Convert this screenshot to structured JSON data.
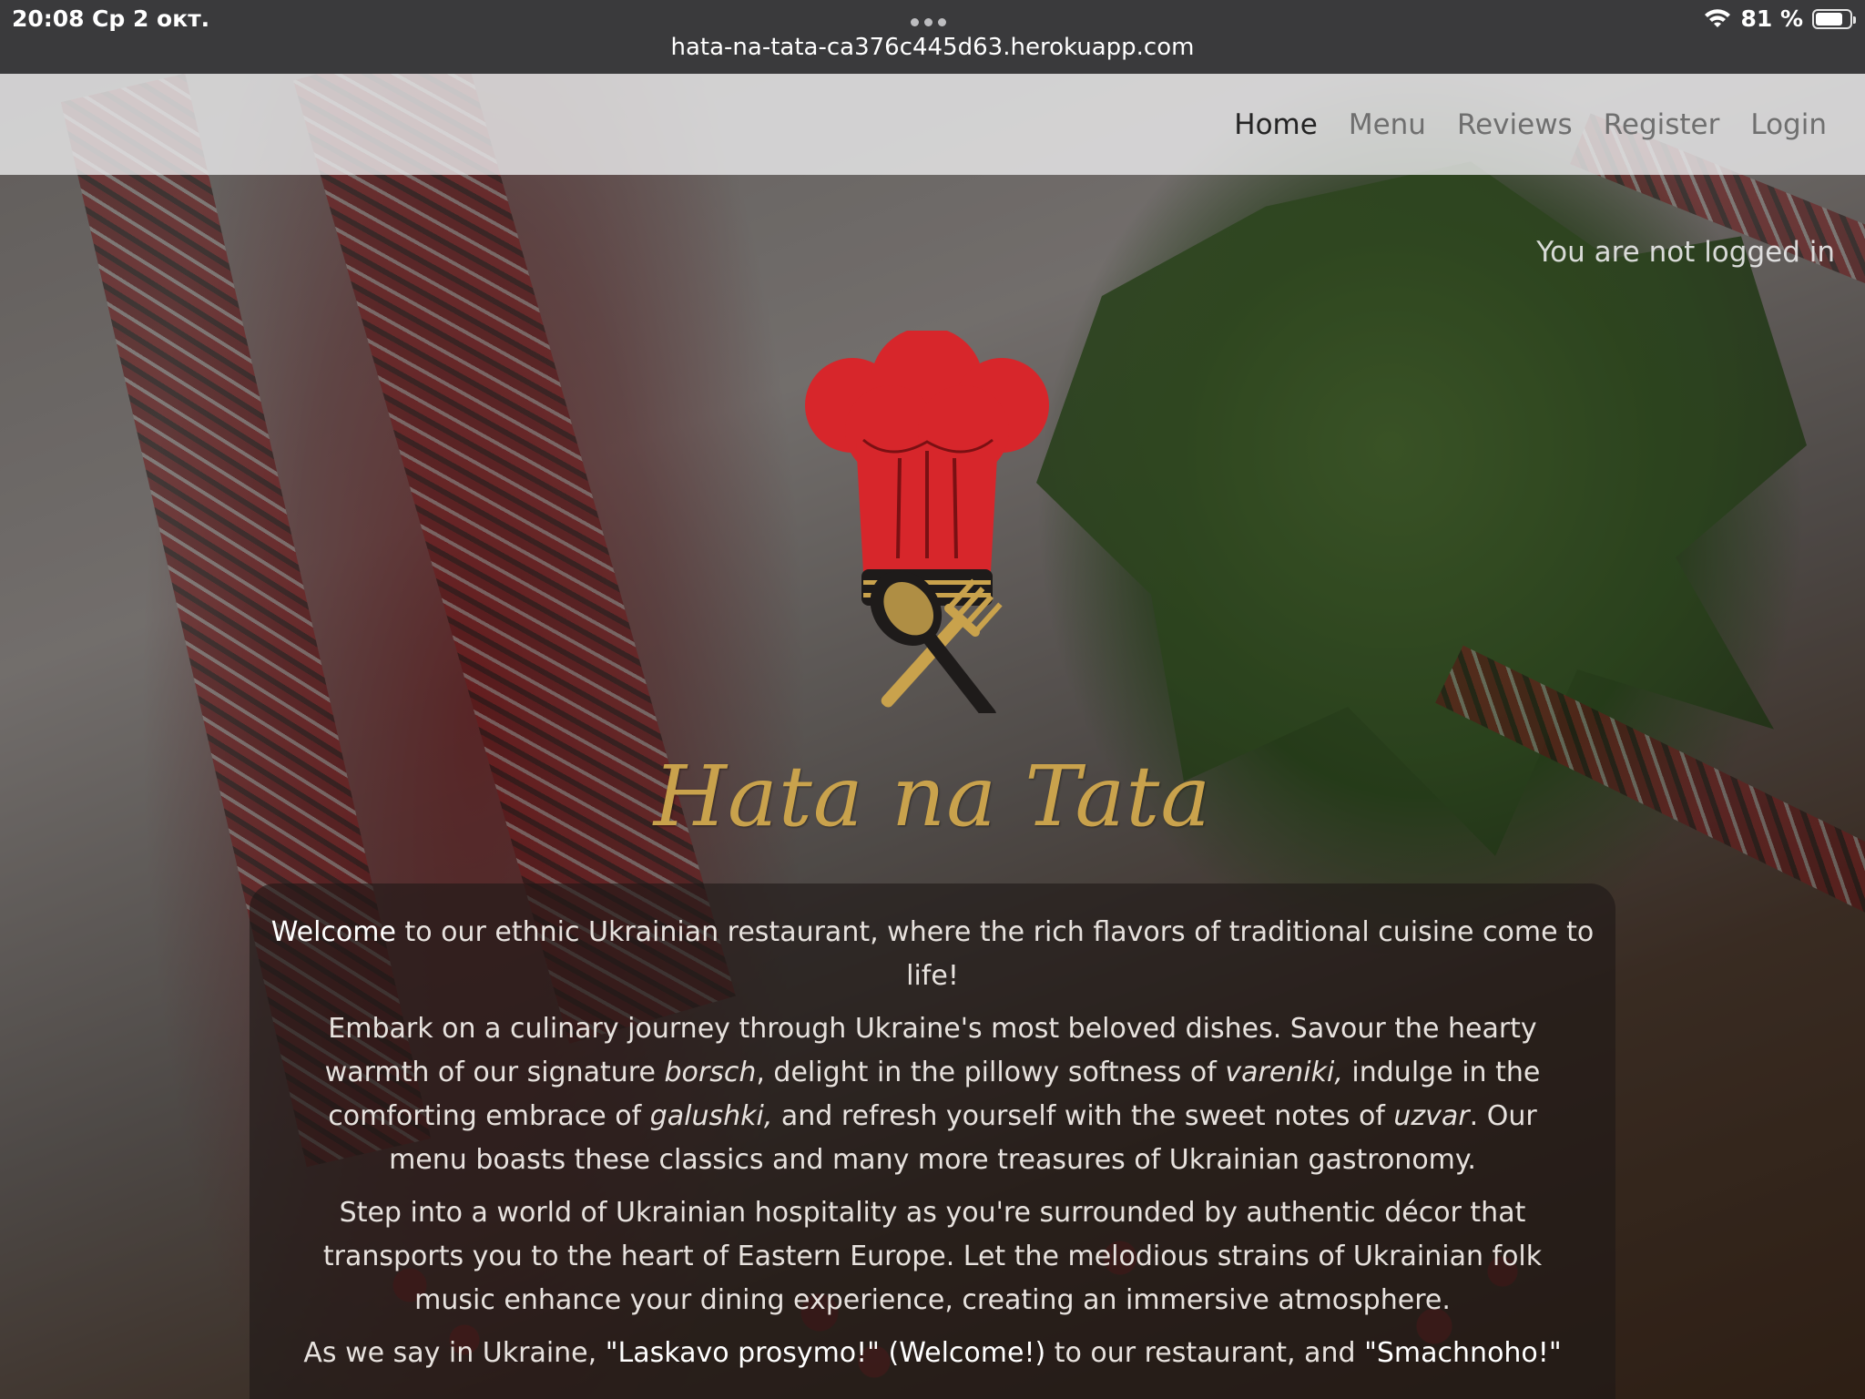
{
  "status_bar": {
    "time": "20:08",
    "date": "Ср 2 окт.",
    "battery": "81 %",
    "battery_level": 0.81,
    "url": "hata-na-tata-ca376c445d63.herokuapp.com"
  },
  "nav": {
    "items": [
      {
        "label": "Home",
        "active": true
      },
      {
        "label": "Menu",
        "active": false
      },
      {
        "label": "Reviews",
        "active": false
      },
      {
        "label": "Register",
        "active": false
      },
      {
        "label": "Login",
        "active": false
      }
    ]
  },
  "login_status": "You are not logged in",
  "brand": {
    "title": "Hata na Tata"
  },
  "content": {
    "p1": {
      "lead": "Welcome",
      "rest": " to our ethnic Ukrainian restaurant, where the rich flavors of traditional cuisine come to life!"
    },
    "p2": {
      "t1": "Embark on a culinary journey through Ukraine's most beloved dishes. Savour the hearty warmth of our signature ",
      "d1": "borsch",
      "t2": ", delight in the pillowy softness of ",
      "d2": "vareniki,",
      "t3": " indulge in the comforting embrace of ",
      "d3": "galushki,",
      "t4": " and refresh yourself with the sweet notes of ",
      "d4": "uzvar",
      "t5": ". Our menu boasts these classics and many more treasures of Ukrainian gastronomy."
    },
    "p3": "Step into a world of Ukrainian hospitality as you're surrounded by authentic décor that transports you to the heart of Eastern Europe. Let the melodious strains of Ukrainian folk music enhance your dining experience, creating an immersive atmosphere.",
    "p4": {
      "t1": "As we say in Ukraine, ",
      "h1": "\"Laskavo prosymo!\" (Welcome!)",
      "t2": " to our restaurant, and ",
      "h2": "\"Smachnoho!\""
    }
  },
  "colors": {
    "brand_gold": "#c9a24c",
    "hat_red": "#d7262b",
    "nav_active": "#242424",
    "nav_inactive": "#6f6f6f"
  }
}
